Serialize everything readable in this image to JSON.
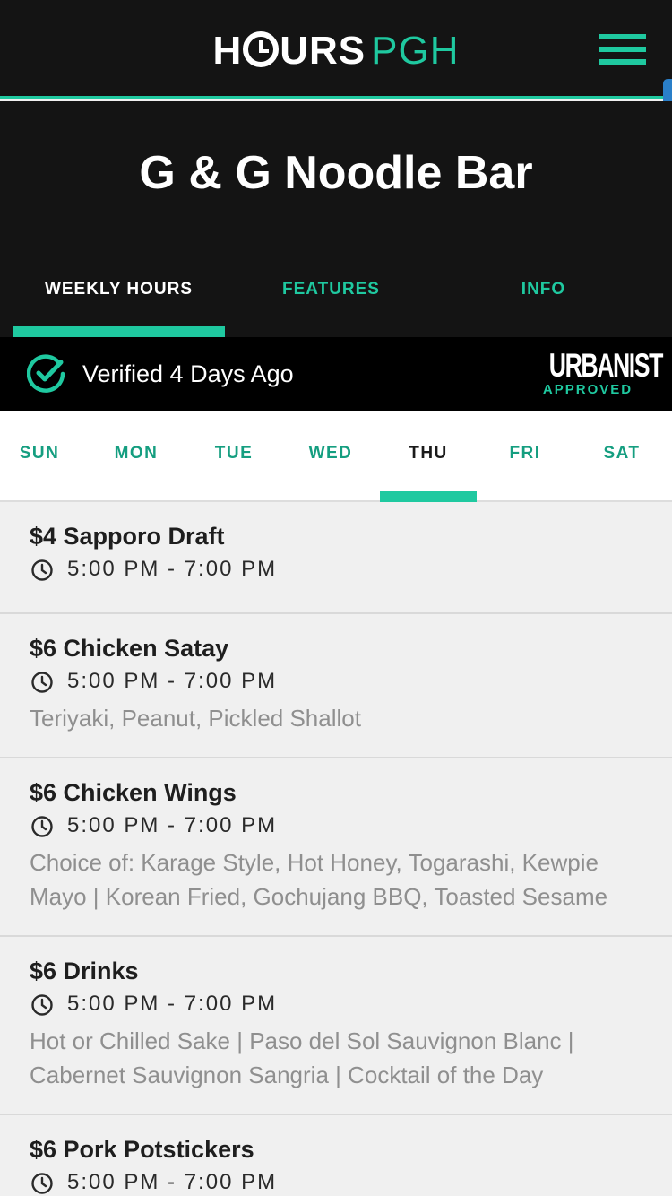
{
  "app": {
    "logo_primary": "H",
    "logo_primary_rest": "URS",
    "logo_secondary": "PGH",
    "menu_icon": "hamburger-icon"
  },
  "colors": {
    "accent": "#1fc9a0",
    "dark": "#141414",
    "bar": "#000000",
    "list_bg": "#f0f0f0"
  },
  "venue": {
    "name": "G & G Noodle Bar"
  },
  "top_tabs": [
    {
      "label": "WEEKLY HOURS",
      "active": true
    },
    {
      "label": "FEATURES",
      "active": false
    },
    {
      "label": "INFO",
      "active": false
    }
  ],
  "verified": {
    "icon": "check-circle-icon",
    "text": "Verified 4 Days Ago",
    "badge_word": "URBANIST",
    "badge_sub": "APPROVED"
  },
  "days": [
    {
      "label": "SUN",
      "active": false
    },
    {
      "label": "MON",
      "active": false
    },
    {
      "label": "TUE",
      "active": false
    },
    {
      "label": "WED",
      "active": false
    },
    {
      "label": "THU",
      "active": true
    },
    {
      "label": "FRI",
      "active": false
    },
    {
      "label": "SAT",
      "active": false
    }
  ],
  "specials": [
    {
      "name": "$4 Sapporo Draft",
      "time": "5:00 PM - 7:00 PM",
      "desc": ""
    },
    {
      "name": "$6 Chicken Satay",
      "time": "5:00 PM - 7:00 PM",
      "desc": "Teriyaki, Peanut, Pickled Shallot"
    },
    {
      "name": "$6 Chicken Wings",
      "time": "5:00 PM - 7:00 PM",
      "desc": "Choice of: Karage Style, Hot Honey, Togarashi, Kewpie Mayo | Korean Fried, Gochujang BBQ, Toasted Sesame"
    },
    {
      "name": "$6 Drinks",
      "time": "5:00 PM - 7:00 PM",
      "desc": "Hot or Chilled Sake | Paso del Sol Sauvignon Blanc | Cabernet Sauvignon Sangria | Cocktail of the Day"
    },
    {
      "name": "$6 Pork Potstickers",
      "time": "5:00 PM - 7:00 PM",
      "desc": ""
    }
  ]
}
